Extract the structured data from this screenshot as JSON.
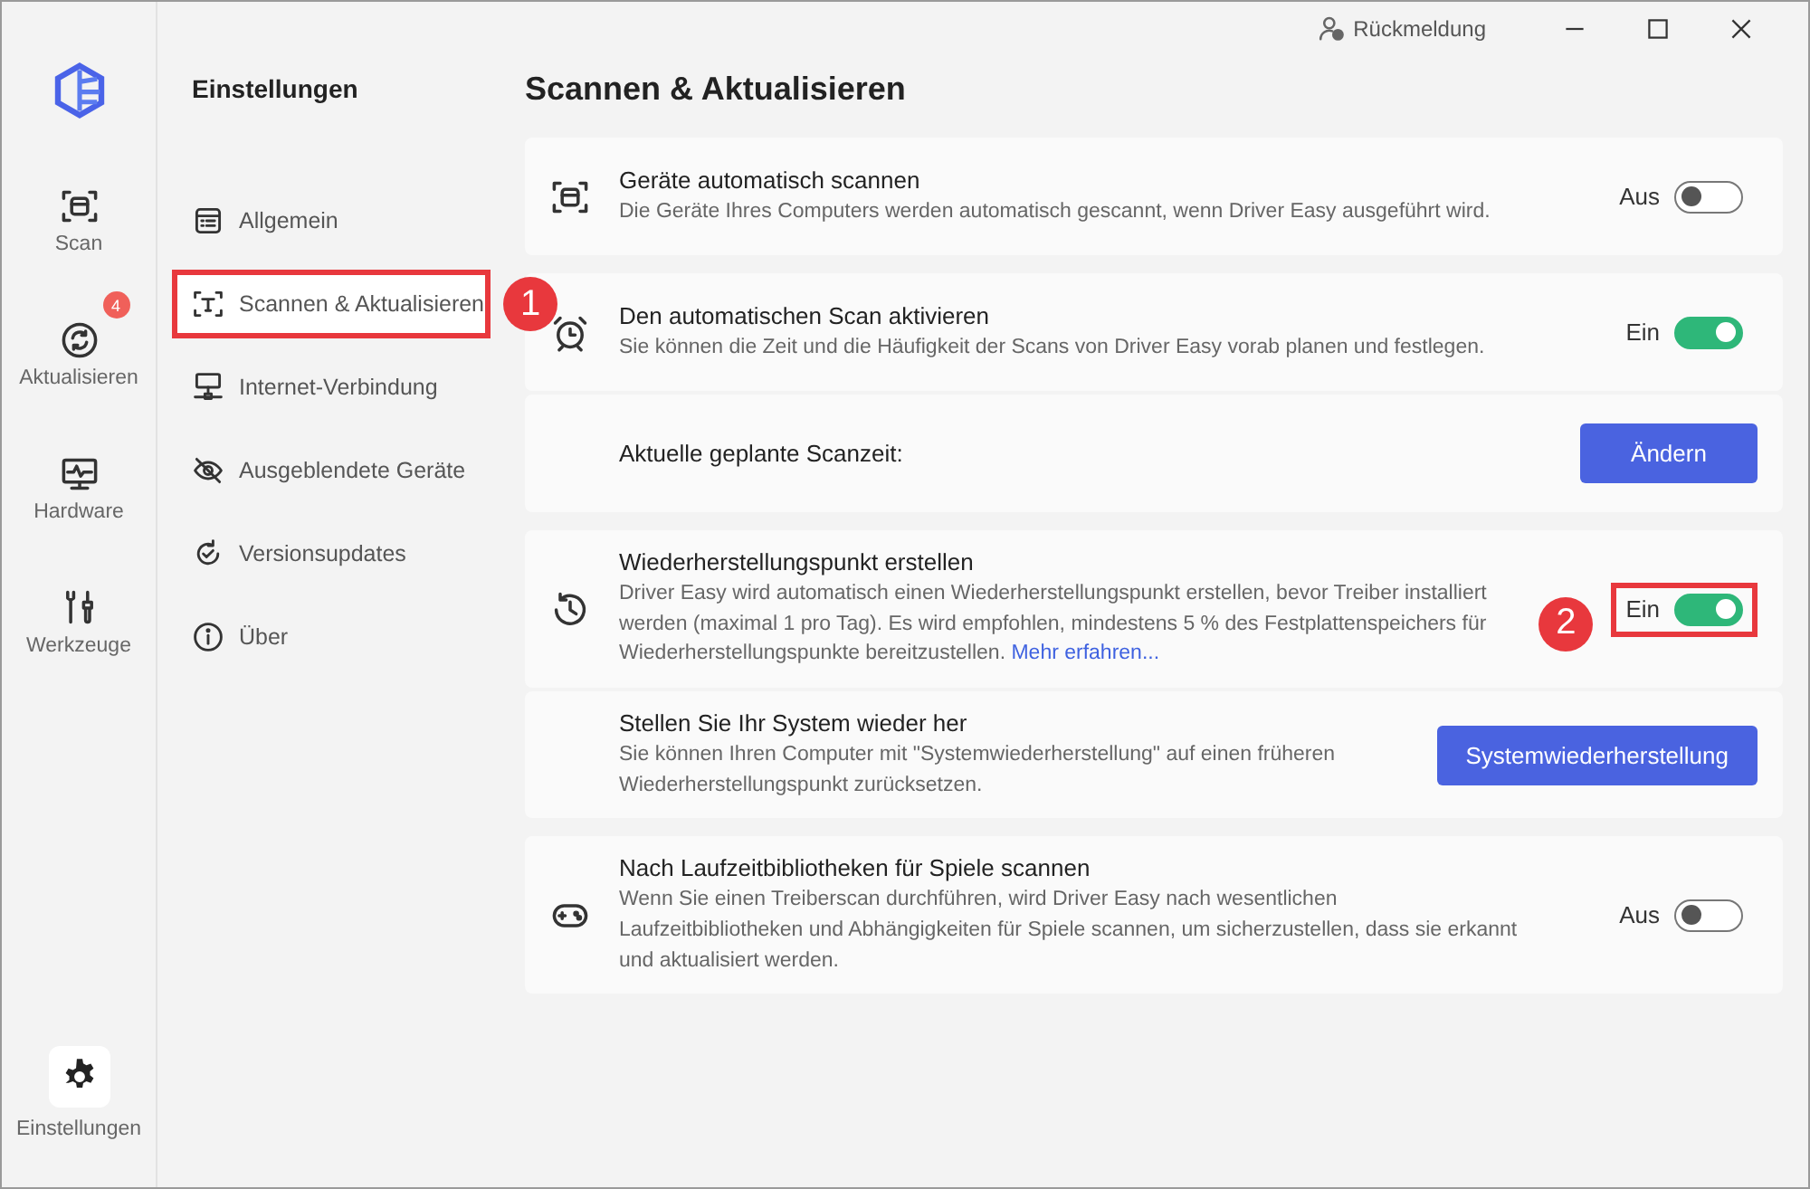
{
  "titlebar": {
    "feedback": "Rückmeldung"
  },
  "rail": [
    {
      "label": "Scan",
      "selected": false
    },
    {
      "label": "Aktualisieren",
      "selected": false,
      "badge": "4"
    },
    {
      "label": "Hardware",
      "selected": false
    },
    {
      "label": "Werkzeuge",
      "selected": false
    }
  ],
  "rail_bottom": {
    "label": "Einstellungen",
    "selected": true
  },
  "nav": {
    "title": "Einstellungen",
    "items": [
      {
        "label": "Allgemein",
        "selected": false
      },
      {
        "label": "Scannen & Aktualisieren",
        "selected": true,
        "callout": "1"
      },
      {
        "label": "Internet-Verbindung",
        "selected": false
      },
      {
        "label": "Ausgeblendete Geräte",
        "selected": false
      },
      {
        "label": "Versionsupdates",
        "selected": false
      },
      {
        "label": "Über",
        "selected": false
      }
    ]
  },
  "page_title": "Scannen & Aktualisieren",
  "cards": [
    {
      "rows": [
        {
          "kind": "toggle",
          "title": "Geräte automatisch scannen",
          "description": "Die Geräte Ihres Computers werden automatisch gescannt, wenn Driver Easy ausgeführt wird.",
          "state_label": "Aus",
          "on": false
        }
      ]
    },
    {
      "rows": [
        {
          "kind": "toggle",
          "title": "Den automatischen Scan aktivieren",
          "description": "Sie können die Zeit und die Häufigkeit der Scans von Driver Easy vorab planen und festlegen.",
          "state_label": "Ein",
          "on": true
        },
        {
          "kind": "button",
          "title": "Aktuelle geplante Scanzeit:",
          "button": "Ändern"
        }
      ]
    },
    {
      "rows": [
        {
          "kind": "toggle",
          "title": "Wiederherstellungspunkt erstellen",
          "description": "Driver Easy wird automatisch einen Wiederherstellungspunkt erstellen, bevor Treiber installiert werden (maximal 1 pro Tag). Es wird empfohlen, mindestens 5 % des Festplattenspeichers für Wiederherstellungspunkte bereitzustellen.",
          "link": "Mehr erfahren...",
          "state_label": "Ein",
          "on": true,
          "callout": "2"
        },
        {
          "kind": "button",
          "title": "Stellen Sie Ihr System wieder her",
          "description": "Sie können Ihren Computer mit \"Systemwiederherstellung\" auf einen früheren Wiederherstellungspunkt zurücksetzen.",
          "button": "Systemwiederherstellung"
        }
      ]
    },
    {
      "rows": [
        {
          "kind": "toggle",
          "title": "Nach Laufzeitbibliotheken für Spiele scannen",
          "description": "Wenn Sie einen Treiberscan durchführen, wird Driver Easy nach wesentlichen Laufzeitbibliotheken und Abhängigkeiten für Spiele scannen, um sicherzustellen, dass sie erkannt und aktualisiert werden.",
          "state_label": "Aus",
          "on": false
        }
      ]
    }
  ]
}
